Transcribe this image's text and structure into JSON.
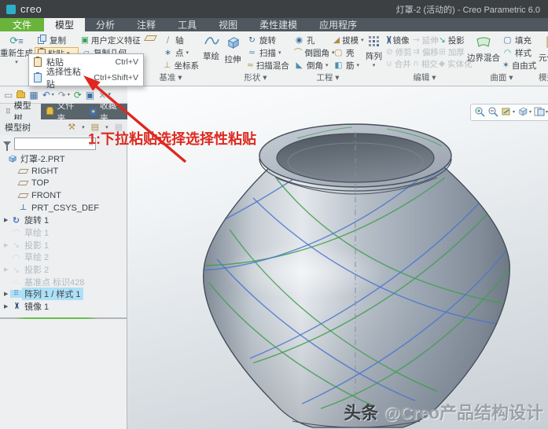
{
  "title_bar": {
    "logo_text": "creo",
    "title": "灯罩-2 (活动的) - Creo Parametric 6.0"
  },
  "tabs": [
    {
      "label": "文件"
    },
    {
      "label": "模型"
    },
    {
      "label": "分析"
    },
    {
      "label": "注释"
    },
    {
      "label": "工具"
    },
    {
      "label": "视图"
    },
    {
      "label": "柔性建模"
    },
    {
      "label": "应用程序"
    }
  ],
  "ribbon": {
    "regenerate": "重新生成",
    "copy": "复制",
    "paste": "粘贴",
    "udf": "用户定义特征",
    "copy_geometry": "复制几何",
    "datum": {
      "axis": "轴",
      "point": "点",
      "csys": "坐标系",
      "group": "基准"
    },
    "sketch": "草绘",
    "shapes": {
      "extrude": "拉伸",
      "revolve": "旋转",
      "sweep": "扫描",
      "swept_blend": "扫描混合",
      "group": "形状"
    },
    "engineering": {
      "hole": "孔",
      "round": "倒圆角",
      "chamfer": "倒角",
      "draft": "拔模",
      "shell": "壳",
      "rib": "筋",
      "group": "工程"
    },
    "pattern": "阵列",
    "editing": {
      "mirror": "镜像",
      "extend": "延伸",
      "project": "投影",
      "trim": "修剪",
      "offset": "偏移",
      "thicken": "加厚",
      "merge": "合并",
      "intersect": "相交",
      "solidify": "实体化",
      "group": "编辑"
    },
    "surfaces": {
      "boundary_blend": "边界混合",
      "fill": "填充",
      "style": "样式",
      "freestyle": "自由式",
      "group": "曲面"
    },
    "model_intent": {
      "component_interface": "元件界面",
      "group": "模型意图"
    }
  },
  "paste_menu": {
    "items": [
      {
        "label": "粘贴",
        "shortcut": "Ctrl+V"
      },
      {
        "label": "选择性粘贴",
        "shortcut": "Ctrl+Shift+V"
      }
    ]
  },
  "panel": {
    "tabs": [
      {
        "label": "模型树"
      },
      {
        "label": "文件夹"
      },
      {
        "label": "收藏夹"
      }
    ],
    "header": "模型树",
    "filter_value": "",
    "tree": [
      {
        "label": "灯罩-2.PRT",
        "state": "normal"
      },
      {
        "label": "RIGHT",
        "state": "normal"
      },
      {
        "label": "TOP",
        "state": "normal"
      },
      {
        "label": "FRONT",
        "state": "normal"
      },
      {
        "label": "PRT_CSYS_DEF",
        "state": "normal"
      },
      {
        "label": "旋转 1",
        "state": "normal"
      },
      {
        "label": "草绘 1",
        "state": "hidden"
      },
      {
        "label": "投影 1",
        "state": "hidden"
      },
      {
        "label": "草绘 2",
        "state": "hidden"
      },
      {
        "label": "投影 2",
        "state": "hidden"
      },
      {
        "label": "基准点 标识428",
        "state": "hidden"
      },
      {
        "label": "阵列 1 / 样式 1",
        "state": "selected"
      },
      {
        "label": "镜像 1",
        "state": "normal"
      }
    ]
  },
  "annotation": {
    "step": "1:下拉粘贴选择选择性粘贴"
  },
  "watermark": {
    "source": "头条",
    "handle": "@Creo产品结构设计"
  },
  "colors": {
    "accent_green": "#6ab43c",
    "logo_teal": "#2cb0c7",
    "selection_blue": "#ade0f6",
    "annotation_red": "#dd2a20",
    "curve_green": "#3f9e4f",
    "curve_blue": "#4a74cc"
  }
}
